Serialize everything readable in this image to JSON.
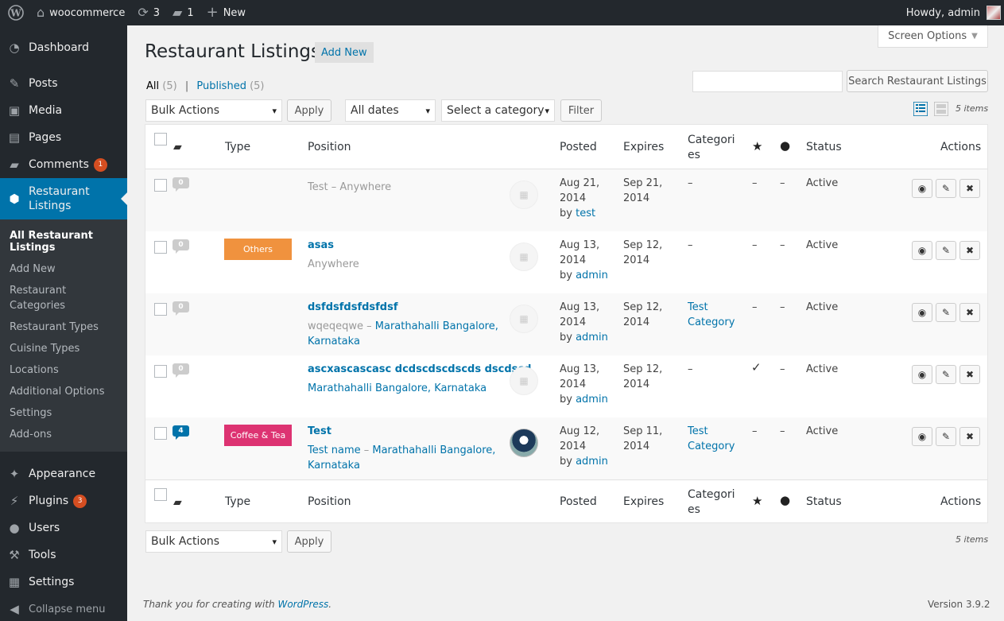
{
  "adminbar": {
    "site_name": "woocommerce",
    "updates_count": "3",
    "comments_count": "1",
    "new_label": "New",
    "howdy": "Howdy, admin"
  },
  "sidebar": {
    "dashboard": "Dashboard",
    "posts": "Posts",
    "media": "Media",
    "pages": "Pages",
    "comments": "Comments",
    "comments_badge": "1",
    "restaurant_listings": "Restaurant Listings",
    "submenu": [
      "All Restaurant Listings",
      "Add New",
      "Restaurant Categories",
      "Restaurant Types",
      "Cuisine Types",
      "Locations",
      "Additional Options",
      "Settings",
      "Add-ons"
    ],
    "appearance": "Appearance",
    "plugins": "Plugins",
    "plugins_badge": "3",
    "users": "Users",
    "tools": "Tools",
    "settings": "Settings",
    "collapse": "Collapse menu"
  },
  "header": {
    "screen_options": "Screen Options",
    "title": "Restaurant Listings",
    "add_new": "Add New"
  },
  "filters": {
    "all_label": "All",
    "all_count": "(5)",
    "separator": "|",
    "published_label": "Published",
    "published_count": "(5)",
    "search_placeholder": "",
    "search_button": "Search Restaurant Listings",
    "bulk_actions": "Bulk Actions",
    "apply": "Apply",
    "all_dates": "All dates",
    "select_category": "Select a category",
    "filter": "Filter",
    "items_count": "5 items"
  },
  "table": {
    "columns": {
      "type": "Type",
      "position": "Position",
      "posted": "Posted",
      "expires": "Expires",
      "categories_line1": "Categori",
      "categories_line2": "es",
      "status": "Status",
      "actions": "Actions"
    },
    "rows": [
      {
        "comments": "0",
        "type": "",
        "type_color": "",
        "title": "Test",
        "title_sep": " – ",
        "location": "Anywhere",
        "location2": "",
        "draft_style": true,
        "posted_line1": "Aug 21,",
        "posted_line2": "2014",
        "by": "by",
        "author": "test",
        "expires_line1": "Sep 21,",
        "expires_line2": "2014",
        "categories_line1": "–",
        "categories_line2": "",
        "featured": "–",
        "filled": "–",
        "status": "Active"
      },
      {
        "comments": "0",
        "type": "Others",
        "type_color": "#f0923e",
        "title": "asas",
        "title_sep": "",
        "location": "Anywhere",
        "location2": "",
        "draft_style": false,
        "posted_line1": "Aug 13,",
        "posted_line2": "2014",
        "by": "by",
        "author": "admin",
        "expires_line1": "Sep 12,",
        "expires_line2": "2014",
        "categories_line1": "–",
        "categories_line2": "",
        "featured": "–",
        "filled": "–",
        "status": "Active"
      },
      {
        "comments": "0",
        "type": "",
        "type_color": "",
        "title": "dsfdsfdsfdsfdsf",
        "subtitle": "wqeqeqwe",
        "title_sep": " – ",
        "location": "Marathahalli Bangalore,",
        "location2": "Karnataka",
        "draft_style": false,
        "posted_line1": "Aug 13,",
        "posted_line2": "2014",
        "by": "by",
        "author": "admin",
        "expires_line1": "Sep 12,",
        "expires_line2": "2014",
        "categories_line1": "Test",
        "categories_line2": "Category",
        "featured": "–",
        "filled": "–",
        "status": "Active"
      },
      {
        "comments": "0",
        "type": "",
        "type_color": "",
        "title": "ascxascascasc dcdscdscdscds dscdscd",
        "title_sep": "",
        "location": "Marathahalli Bangalore, Karnataka",
        "location2": "",
        "draft_style": false,
        "posted_line1": "Aug 13,",
        "posted_line2": "2014",
        "by": "by",
        "author": "admin",
        "expires_line1": "Sep 12,",
        "expires_line2": "2014",
        "categories_line1": "–",
        "categories_line2": "",
        "featured": "✓",
        "filled": "–",
        "status": "Active"
      },
      {
        "comments": "4",
        "type": "Coffee & Tea",
        "type_color": "#dd3372",
        "title": "Test",
        "subtitle": "Test name",
        "title_sep": " – ",
        "location": "Marathahalli Bangalore,",
        "location2": "Karnataka",
        "draft_style": false,
        "posted_line1": "Aug 12,",
        "posted_line2": "2014",
        "by": "by",
        "author": "admin",
        "expires_line1": "Sep 11,",
        "expires_line2": "2014",
        "categories_line1": "Test",
        "categories_line2": "Category",
        "featured": "–",
        "filled": "–",
        "status": "Active"
      }
    ]
  },
  "footer": {
    "thanks_prefix": "Thank you for creating with ",
    "wordpress": "WordPress",
    "thanks_suffix": ".",
    "version": "Version 3.9.2"
  }
}
